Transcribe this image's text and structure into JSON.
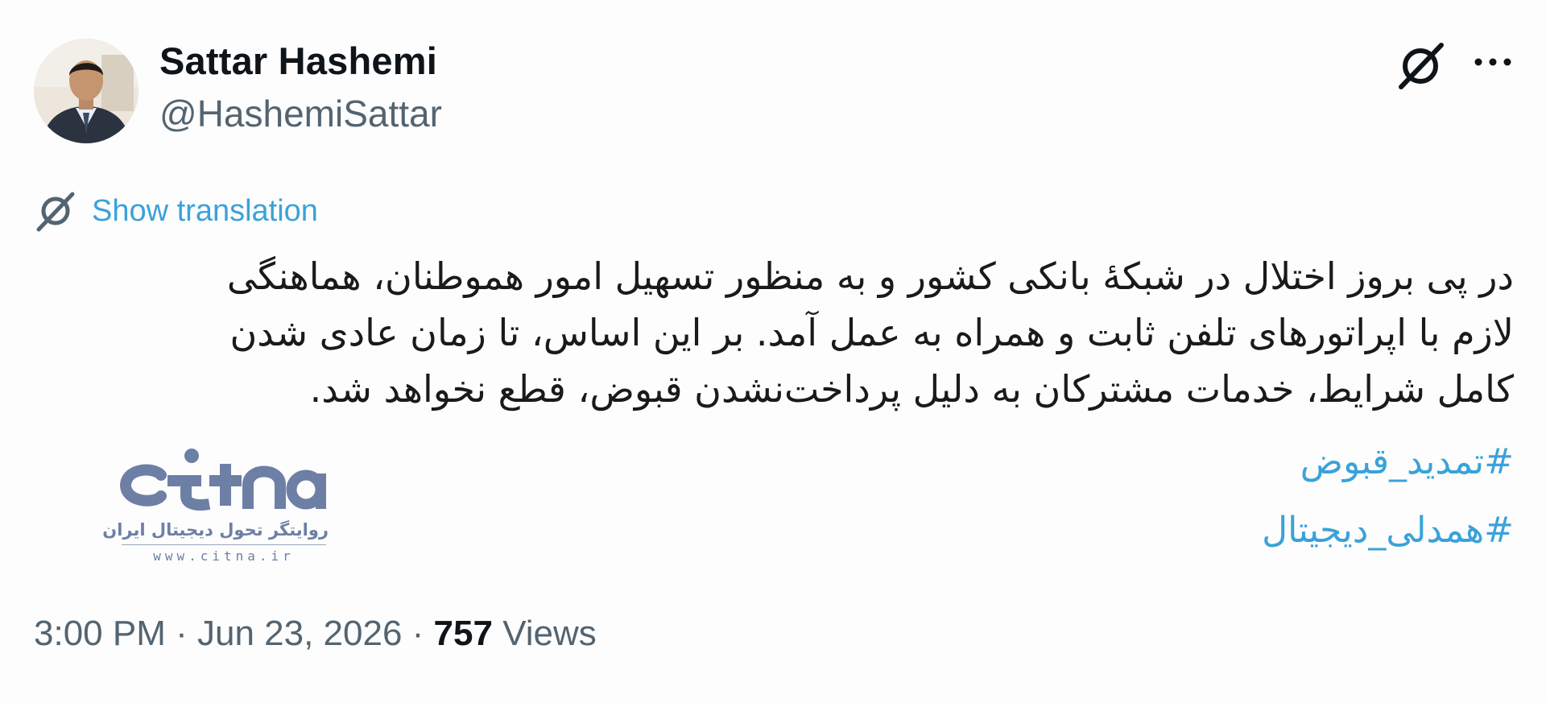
{
  "author": {
    "display_name": "Sattar Hashemi",
    "handle": "@HashemiSattar"
  },
  "header_icons": {
    "grok": "grok-icon",
    "more": "more-icon"
  },
  "translation": {
    "label": "Show translation",
    "icon": "grok-icon"
  },
  "tweet": {
    "lines": [
      "در پی بروز اختلال در شبکهٔ بانکی کشور و به منظور تسهیل امور هموطنان، هماهنگی",
      "لازم با اپراتورهای تلفن ثابت و همراه به عمل آمد. بر این اساس، تا زمان عادی شدن",
      "کامل شرایط، خدمات مشترکان به دلیل پرداخت‌نشدن قبوض، قطع نخواهد شد."
    ],
    "hashtags": [
      "#تمدید_قبوض",
      "#همدلی_دیجیتال"
    ]
  },
  "watermark": {
    "logo": "citna",
    "tagline": "روایتگر تحول دیجیتال ایران",
    "url": "www.citna.ir"
  },
  "meta": {
    "time": "3:00 PM",
    "separator": " · ",
    "date": "Jun 23, 2026",
    "views_count": "757",
    "views_label": "Views"
  },
  "colors": {
    "link": "#3aa2d9",
    "secondary_text": "#536471",
    "primary_text": "#0f1419",
    "watermark": "#6e7fa6"
  }
}
